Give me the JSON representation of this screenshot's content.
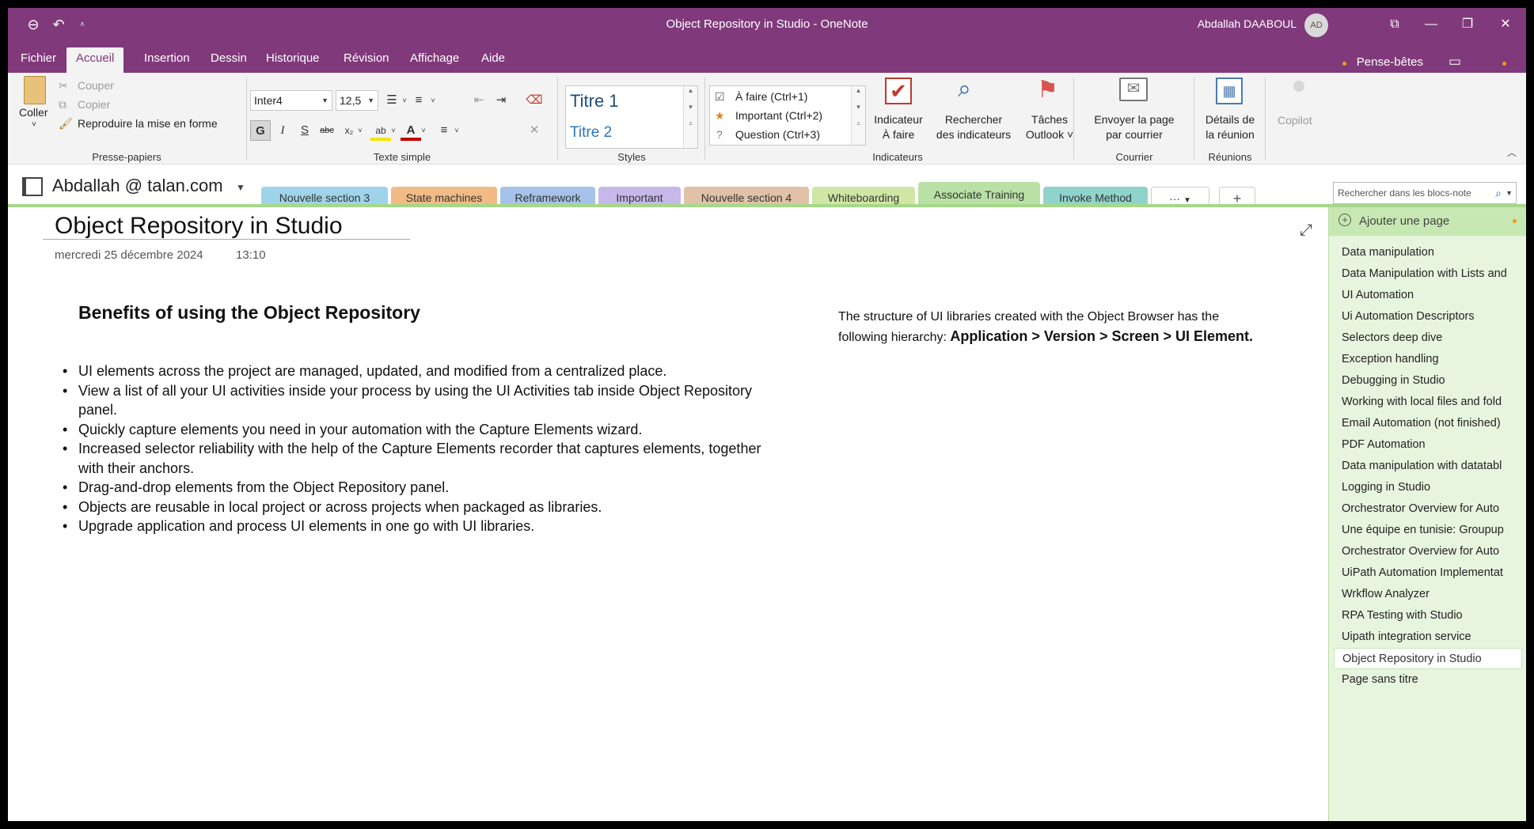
{
  "window": {
    "title": "Object Repository in Studio  -  OneNote",
    "user_name": "Abdallah DAABOUL",
    "user_initials": "AD"
  },
  "menu": {
    "tabs": [
      "Fichier",
      "Accueil",
      "Insertion",
      "Dessin",
      "Historique",
      "Révision",
      "Affichage",
      "Aide"
    ],
    "active": "Accueil",
    "pense_betes": "Pense-bêtes"
  },
  "ribbon": {
    "clipboard": {
      "paste": "Coller",
      "cut": "Couper",
      "copy": "Copier",
      "format_painter": "Reproduire la mise en forme",
      "label": "Presse-papiers"
    },
    "basic_text": {
      "font": "Inter4",
      "size": "12,5",
      "label": "Texte simple"
    },
    "styles": {
      "title1": "Titre 1",
      "title2": "Titre 2",
      "label": "Styles"
    },
    "tags": {
      "items": [
        "À faire (Ctrl+1)",
        "Important (Ctrl+2)",
        "Question (Ctrl+3)"
      ],
      "todo_tag_line1": "Indicateur",
      "todo_tag_line2": "À faire",
      "find_tags_line1": "Rechercher",
      "find_tags_line2": "des indicateurs",
      "outlook_tasks_line1": "Tâches",
      "outlook_tasks_line2": "Outlook ˅",
      "label": "Indicateurs"
    },
    "email": {
      "line1": "Envoyer la page",
      "line2": "par courrier",
      "label": "Courrier"
    },
    "meetings": {
      "line1": "Détails de",
      "line2": "la réunion",
      "label": "Réunions"
    },
    "copilot": "Copilot"
  },
  "notebook": {
    "name": "Abdallah @ talan.com",
    "sections": [
      "Nouvelle section 3",
      "State machines",
      "Reframework",
      "Important",
      "Nouvelle section 4",
      "Whiteboarding",
      "Associate Training",
      "Invoke Method"
    ],
    "more": "···",
    "add": "+",
    "search_placeholder": "Rechercher dans les blocs-note"
  },
  "page": {
    "title": "Object Repository in Studio",
    "date": "mercredi 25 décembre 2024",
    "time": "13:10",
    "heading": "Benefits of using the Object Repository",
    "bullets": [
      "UI elements across the project are managed, updated, and modified from a centralized place.",
      "View a list of all your UI activities inside your process by using the UI Activities tab inside Object Repository panel.",
      "Quickly capture elements you need in your automation with the Capture Elements wizard.",
      "Increased selector reliability with the help of the Capture Elements recorder that captures elements, together with their anchors.",
      "Drag-and-drop elements from the Object Repository panel.",
      "Objects are reusable in local project or across projects when packaged as libraries.",
      "Upgrade application and process UI elements in one go with UI libraries."
    ],
    "note_intro": "The structure of UI libraries created with the Object Browser has the following hierarchy: ",
    "note_bold": "Application > Version > Screen > UI Element."
  },
  "pages": {
    "add_label": "Ajouter une page",
    "items": [
      "Data manipulation",
      "Data Manipulation with Lists and",
      "UI Automation",
      "Ui Automation Descriptors",
      "Selectors deep dive",
      "Exception handling",
      "Debugging in Studio",
      "Working with local files and fold",
      "Email Automation (not finished)",
      "PDF Automation",
      "Data manipulation with datatabl",
      "Logging in Studio",
      "Orchestrator Overview for Auto",
      "Une équipe en tunisie: Groupup",
      "Orchestrator Overview for Auto",
      "UiPath Automation Implementat",
      "Wrkflow Analyzer",
      "RPA Testing with Studio",
      "Uipath integration service",
      "Object Repository in Studio",
      "Page sans titre"
    ],
    "selected_index": 19
  },
  "colors": {
    "brand": "#80397b",
    "section_tabs": [
      "#9fd3ea",
      "#f2bb86",
      "#a6c2e8",
      "#c7b8ea",
      "#e1c2a8",
      "#cfe6a4",
      "#b9e0a5",
      "#8fd4cc"
    ],
    "page_list_bg": "#e7f5de"
  }
}
